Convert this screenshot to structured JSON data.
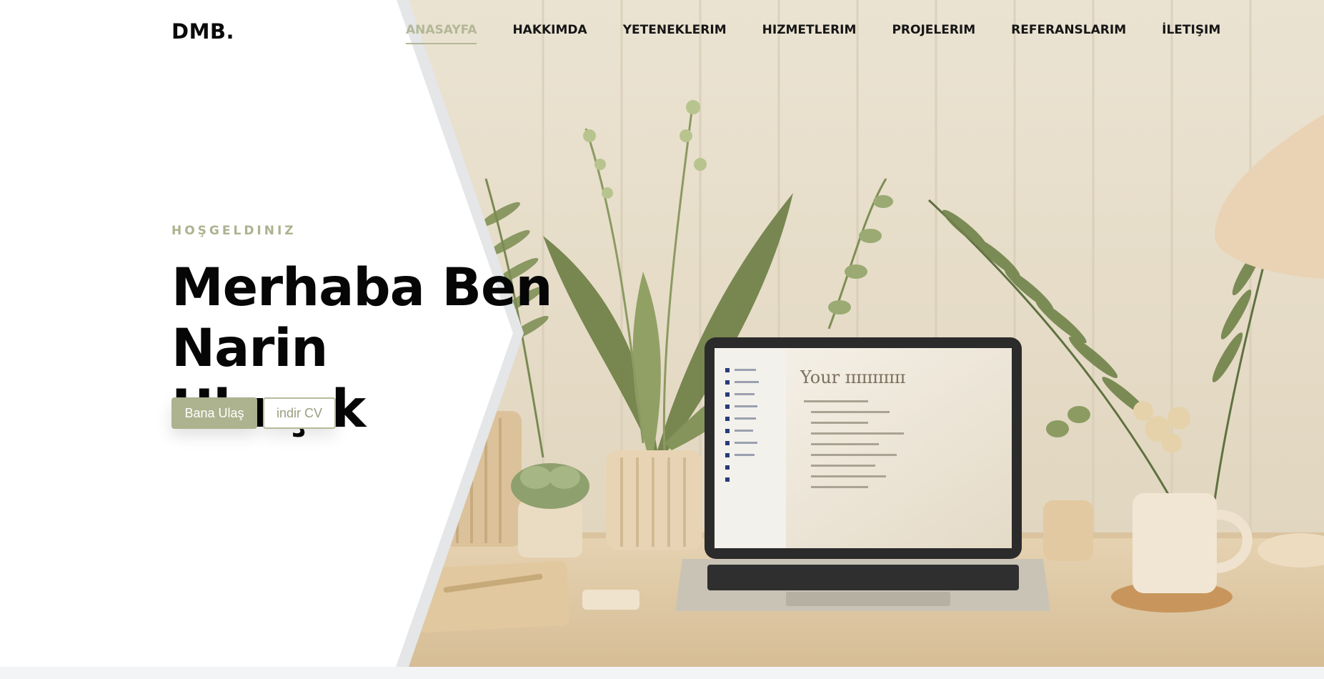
{
  "brand": {
    "logo": "DMB."
  },
  "nav": {
    "items": [
      {
        "label": "ANASAYFA",
        "active": true
      },
      {
        "label": "HAKKIMDA",
        "active": false
      },
      {
        "label": "YETENEKLERIM",
        "active": false
      },
      {
        "label": "HIZMETLERIM",
        "active": false
      },
      {
        "label": "PROJELERIM",
        "active": false
      },
      {
        "label": "REFERANSLARIM",
        "active": false
      },
      {
        "label": "İLETIŞIM",
        "active": false
      }
    ]
  },
  "hero": {
    "eyebrow": "HOŞGELDINIZ",
    "title_line1": "Merhaba Ben Narin",
    "title_line2": "Uluışık",
    "primary_button": "Bana Ulaş",
    "secondary_button": "indir CV"
  },
  "illustration": {
    "laptop_screen_heading": "Your ɪɪɪɪɪɪɪɪɪɪɪ"
  },
  "colors": {
    "accent": "#adb28f",
    "text_dark": "#060606",
    "background": "#ffffff"
  }
}
